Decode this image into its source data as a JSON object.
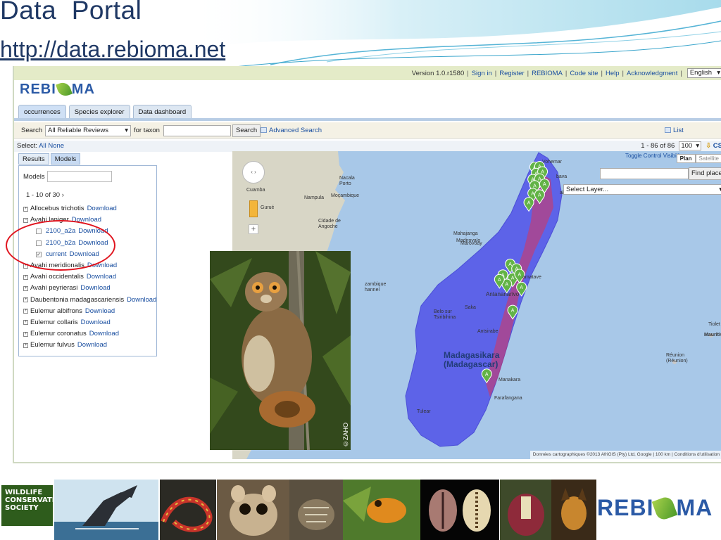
{
  "slide": {
    "title": "Data  Portal",
    "url": "http://data.rebioma.net"
  },
  "topbar": {
    "version": "Version 1.0.r1580",
    "links": [
      "Sign in",
      "Register",
      "REBIOMA",
      "Code site",
      "Help",
      "Acknowledgment"
    ],
    "language": "English"
  },
  "logo": {
    "left": "REBI",
    "right": "MA"
  },
  "tabs": [
    "occurrences",
    "Species explorer",
    "Data dashboard"
  ],
  "search": {
    "label": "Search",
    "filter_value": "All Reliable Reviews",
    "for_taxon_label": "for taxon",
    "taxon_value": "",
    "button": "Search",
    "advanced": "Advanced Search",
    "list": "List"
  },
  "selectbar": {
    "label": "Select:",
    "all": "All",
    "none": "None",
    "range": "1 - 86 of 86",
    "page_size": "100",
    "csv": "CS"
  },
  "left_tabs": [
    "Results",
    "Models"
  ],
  "models": {
    "label": "Models",
    "count": "1 - 10 of 30",
    "next": "›",
    "download_label": "Download",
    "items": [
      {
        "name": "Allocebus trichotis",
        "expander": "+"
      },
      {
        "name": "Avahi laniger",
        "expander": "−"
      },
      {
        "name": "2100_a2a",
        "child": true,
        "checked": false
      },
      {
        "name": "2100_b2a",
        "child": true,
        "checked": false
      },
      {
        "name": "current",
        "child": true,
        "checked": true
      },
      {
        "name": "Avahi meridionalis",
        "expander": "+"
      },
      {
        "name": "Avahi occidentalis",
        "expander": "+"
      },
      {
        "name": "Avahi peyrierasi",
        "expander": "+"
      },
      {
        "name": "Daubentonia madagascariensis",
        "expander": "+"
      },
      {
        "name": "Eulemur albifrons",
        "expander": "+"
      },
      {
        "name": "Eulemur collaris",
        "expander": "+"
      },
      {
        "name": "Eulemur coronatus",
        "expander": "+"
      },
      {
        "name": "Eulemur fulvus",
        "expander": "+"
      }
    ]
  },
  "map": {
    "toggle_control": "Toggle Control Visibility",
    "plan": "Plan",
    "satellite": "Satellite",
    "find_place": "Find place",
    "select_layer": "Select Layer...",
    "attribution": "Données cartographiques ©2013 AfriGIS (Pty) Ltd, Google  |  100 km  |  Conditions d'utilisation",
    "labels": {
      "cuamba": "Cuamba",
      "gurue": "Gurué",
      "nampula": "Nampula",
      "nacala": "Nacala\nPorto",
      "mocambique": "Moçambique",
      "cidade": "Cidade de\nAngoche",
      "mozambique_channel": "zambique\nhannel",
      "vohemar": "Vohemar",
      "sambava": "bava",
      "antalaha": "alaha",
      "mahajanga": "Mahajanga",
      "marovoay": "Marovoay",
      "madirovalo": "Madirovalo",
      "toamasina": "amatave",
      "antananarivo": "Antananarivo",
      "saka": "Saka",
      "belo": "Belo sur\nTsiribihina",
      "antsirabe": "Antsirabe",
      "madagasikara": "Madagasikara\n(Madagascar)",
      "manakara": "Manakara",
      "farafangana": "Farafangana",
      "tulear": "Tulear",
      "reunion": "Réunion\n(Réunion)",
      "tiolet": "Tiolet",
      "mauritius": "Mauritius"
    },
    "marker_letter": "A",
    "markers": [
      [
        0.617,
        0.08
      ],
      [
        0.627,
        0.078
      ],
      [
        0.62,
        0.1
      ],
      [
        0.633,
        0.095
      ],
      [
        0.613,
        0.12
      ],
      [
        0.627,
        0.118
      ],
      [
        0.617,
        0.14
      ],
      [
        0.637,
        0.135
      ],
      [
        0.613,
        0.165
      ],
      [
        0.627,
        0.17
      ],
      [
        0.605,
        0.195
      ],
      [
        0.59,
        0.47
      ],
      [
        0.567,
        0.395
      ],
      [
        0.58,
        0.41
      ],
      [
        0.552,
        0.43
      ],
      [
        0.572,
        0.44
      ],
      [
        0.56,
        0.46
      ],
      [
        0.545,
        0.445
      ],
      [
        0.586,
        0.428
      ],
      [
        0.572,
        0.545
      ],
      [
        0.519,
        0.752
      ]
    ],
    "marker_color": "#62b346"
  },
  "photo": {
    "credit": "©ZAHO"
  },
  "bottom": {
    "wcs_text": "WILDLIFE\nCONSERVATION\nSOCIETY",
    "logo_left": "REBI",
    "logo_right": "MA"
  },
  "colors": {
    "title": "#1f3864",
    "link": "#1a4fa0",
    "land": "#5d63e8",
    "land_dark": "#4b4fd6",
    "hotspot": "#d9355a",
    "sea": "#a8c8e8",
    "africa": "#d8d6c6",
    "ring": "#e0141e"
  }
}
